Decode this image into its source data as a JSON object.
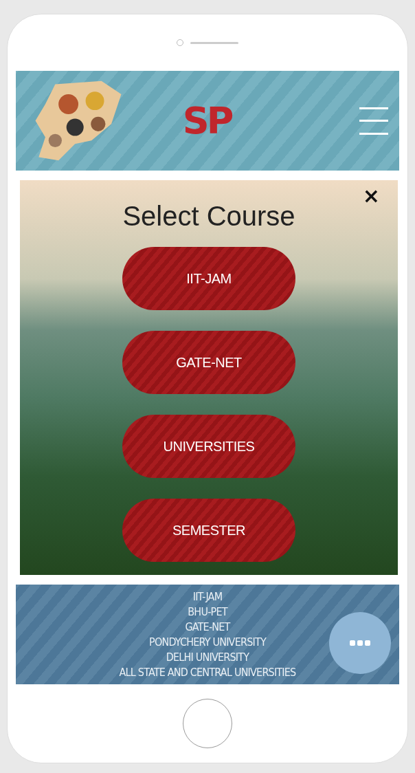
{
  "header": {
    "logo_text": "SP"
  },
  "modal": {
    "title": "Select Course",
    "close": "×",
    "courses": [
      "IIT-JAM",
      "GATE-NET",
      "UNIVERSITIES",
      "SEMESTER"
    ]
  },
  "exam_list": [
    "IIT-JAM",
    "BHU-PET",
    "GATE-NET",
    "PONDYCHERY UNIVERSITY",
    "DELHI UNIVERSITY",
    "ALL STATE AND CENTRAL UNIVERSITIES"
  ]
}
